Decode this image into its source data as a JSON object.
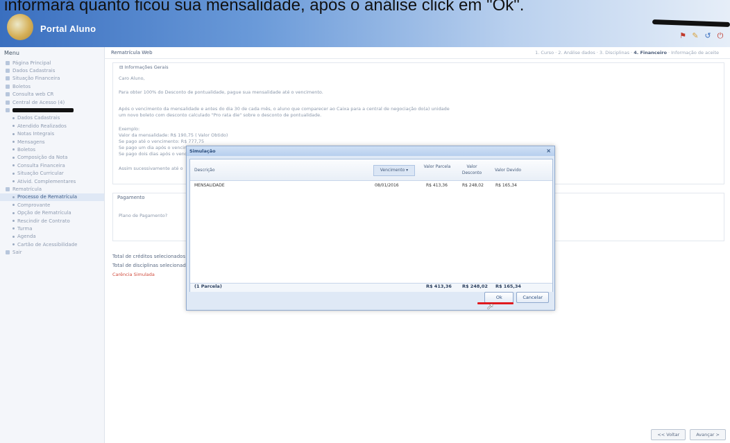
{
  "caption": "e informará quanto ficou sua mensalidade, após o análise click em \"Ok\".",
  "header": {
    "logo_text": "Portal Aluno"
  },
  "sidebar": {
    "title": "Menu",
    "items": [
      {
        "label": "Página Principal",
        "level": 0
      },
      {
        "label": "Dados Cadastrais",
        "level": 0
      },
      {
        "label": "Situação Financeira",
        "level": 0
      },
      {
        "label": "Boletos",
        "level": 0
      },
      {
        "label": "Consulta web CR",
        "level": 0
      },
      {
        "label": "Central de Acesso (4)",
        "level": 0
      },
      {
        "label": "",
        "level": 0,
        "redacted": true
      },
      {
        "label": "Dados Cadastrais",
        "level": 1
      },
      {
        "label": "Atendido Realizados",
        "level": 1
      },
      {
        "label": "Notas Integrais",
        "level": 1
      },
      {
        "label": "Mensagens",
        "level": 1
      },
      {
        "label": "Boletos",
        "level": 1
      },
      {
        "label": "Composição da Nota",
        "level": 1
      },
      {
        "label": "Consulta Financeira",
        "level": 1
      },
      {
        "label": "Situação Curricular",
        "level": 1
      },
      {
        "label": "Ativid. Complementares",
        "level": 1
      },
      {
        "label": "Rematrícula",
        "level": 0
      },
      {
        "label": "Processo de Rematrícula",
        "level": 1,
        "active": true
      },
      {
        "label": "Comprovante",
        "level": 1
      },
      {
        "label": "Opção de Rematrícula",
        "level": 1
      },
      {
        "label": "Rescindir de Contrato",
        "level": 1
      },
      {
        "label": "Turma",
        "level": 1
      },
      {
        "label": "Agenda",
        "level": 1
      },
      {
        "label": "Cartão de Acessibilidade",
        "level": 1
      },
      {
        "label": "Sair",
        "level": 0
      }
    ]
  },
  "content": {
    "section_title": "Rematrícula Web",
    "steps_prefix": "1. Curso · 2. Análise dados · 3. Disciplinas · ",
    "steps_active": "4. Financeiro",
    "steps_suffix": " · Informação de aceite",
    "info_panel": {
      "title": "Informações Gerais",
      "lines": [
        "Caro Aluno,",
        "Para obter 100% do Desconto de pontualidade, pague sua mensalidade até o vencimento.",
        "Após o vencimento da mensalidade e antes do dia 30 de cada mês, o aluno que comparecer ao Caixa para a central de negociação do(a) unidade",
        "um novo boleto com desconto calculado \"Pro rata die\" sobre o desconto de pontualidade.",
        "Exemplo:",
        "Valor da mensalidade: R$ 190,75 ( Valor Obtido)",
        "Se pago até o vencimento: R$ 777,75",
        "Se pago um dia após o vencimento",
        "Se pago dois dias após o venc",
        "Assim sucessivamente até o"
      ]
    },
    "payment_panel": {
      "title": "Pagamento",
      "label": "Plano de Pagamento?"
    },
    "totals": {
      "credits": "Total de créditos selecionados",
      "disciplines": "Total de disciplinas selecionadas",
      "red_text": "Carência Simulada"
    },
    "footer": {
      "back": "<< Voltar",
      "next": "Avançar >"
    }
  },
  "dialog": {
    "title": "Simulação",
    "columns": [
      "Descrição",
      "Vencimento",
      "Valor Parcela",
      "Valor Desconto",
      "Valor Devido"
    ],
    "rows": [
      {
        "descricao": "MENSALIDADE",
        "vencimento": "08/01/2016",
        "parcela": "R$ 413,36",
        "desconto": "R$ 248,02",
        "devido": "R$ 165,34"
      }
    ],
    "footer": {
      "label": "(1 Parcela)",
      "parcela": "R$ 413,36",
      "desconto": "R$ 248,02",
      "devido": "R$ 165,34"
    },
    "ok_label": "Ok",
    "cancel_label": "Cancelar"
  }
}
